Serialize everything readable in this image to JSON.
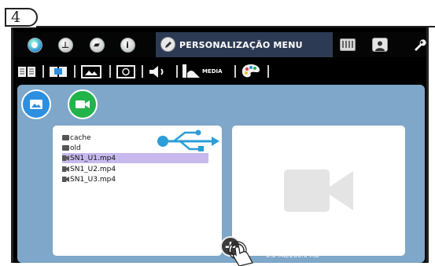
{
  "step": {
    "number": "4"
  },
  "topbar": {
    "icons": [
      {
        "name": "drop-icon",
        "glyph": "💧"
      },
      {
        "name": "clock-icon",
        "glyph": "⏲"
      },
      {
        "name": "flag-icon",
        "glyph": "⚑"
      },
      {
        "name": "info-icon",
        "glyph": "i"
      }
    ],
    "active_menu": {
      "label": "PERSONALIZAÇÃO MENU",
      "icon": "pencil-icon"
    },
    "right_icons": [
      {
        "name": "keyboard-icon"
      },
      {
        "name": "user-icon"
      },
      {
        "name": "wrench-icon"
      }
    ]
  },
  "subbar": {
    "icons": [
      "book-icon",
      "book-open-icon",
      "image-frame-icon",
      "target-icon",
      "speaker-icon",
      "media-icon",
      "palette-icon"
    ],
    "media_label": "MEDIA"
  },
  "media_panel": {
    "buttons": [
      {
        "name": "image-button",
        "icon": "image-icon",
        "color": "#2d8fe0"
      },
      {
        "name": "video-button",
        "icon": "video-camera-icon",
        "color": "#22b34a"
      }
    ],
    "files": [
      {
        "name": "cache",
        "type": "folder",
        "selected": false
      },
      {
        "name": "old",
        "type": "folder",
        "selected": false
      },
      {
        "name": "SN1_U1.mp4",
        "type": "video",
        "selected": true
      },
      {
        "name": "SN1_U2.mp4",
        "type": "video",
        "selected": false
      },
      {
        "name": "SN1_U3.mp4",
        "type": "video",
        "selected": false
      }
    ],
    "storage": "0.0 Mb/200.0 MB",
    "usb_icon": "usb-icon",
    "preview_icon": "video-camera-icon",
    "add_icon": "plus-icon"
  },
  "colors": {
    "panel_bg": "#7ea7c9",
    "active_menu_bg": "#2d3a53",
    "selection": "#c7b9ee",
    "usb": "#2a9ed8"
  }
}
